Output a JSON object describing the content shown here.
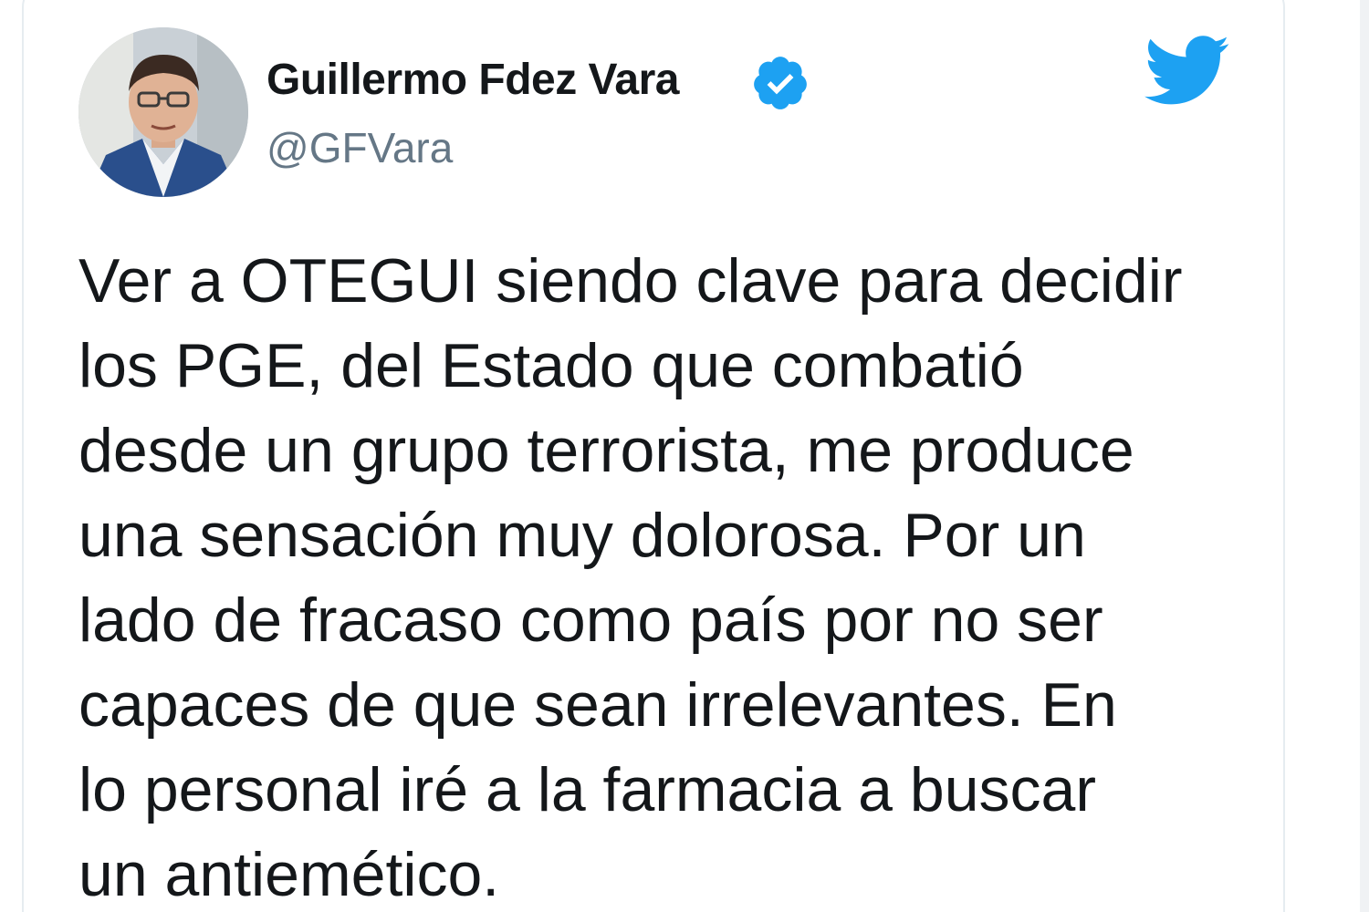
{
  "tweet": {
    "author": {
      "name": "Guillermo Fdez Vara",
      "handle": "@GFVara",
      "verified": true
    },
    "text": "Ver a OTEGUI siendo clave para decidir\nlos PGE,  del Estado que combatió\ndesde un grupo terrorista,  me produce\nuna sensación muy dolorosa. Por un\nlado de fracaso como país por no ser\ncapaces de que sean irrelevantes. En\nlo personal iré a la farmacia a buscar\nun antiemético."
  },
  "icons": {
    "avatar": "profile-photo",
    "verified": "verified-badge-icon",
    "brand": "twitter-bird-icon"
  },
  "colors": {
    "brand_blue": "#1da1f2",
    "text_primary": "#14171a",
    "text_secondary": "#657786",
    "card_border": "#e6ecf0"
  }
}
